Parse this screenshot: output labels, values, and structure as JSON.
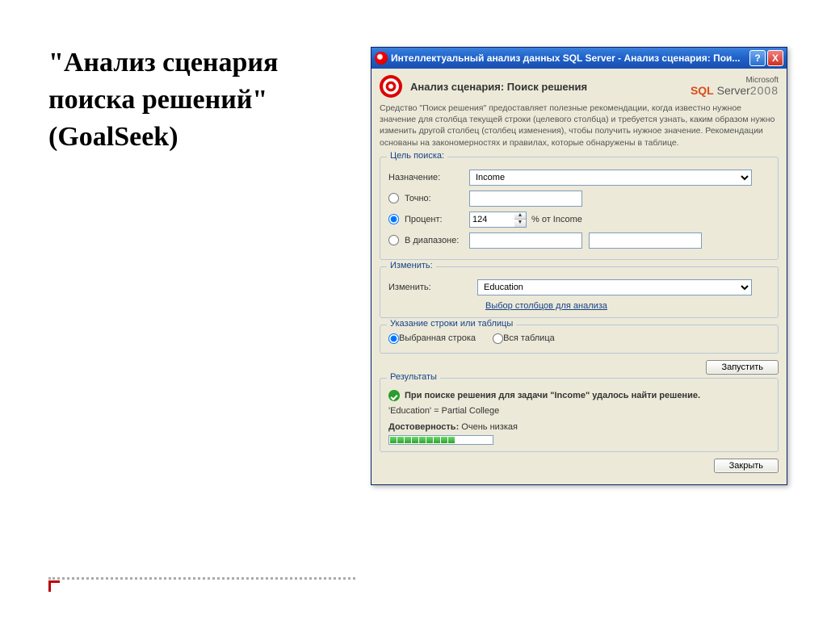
{
  "slide": {
    "title_line1": "\"Анализ сценария",
    "title_line2": "поиска решений\"",
    "title_line3": "(GoalSeek)"
  },
  "window": {
    "title": "Интеллектуальный анализ данных SQL Server  -  Анализ сценария: Пои...",
    "help": "?",
    "close": "X"
  },
  "header": {
    "heading": "Анализ сценария: Поиск решения",
    "logo_top": "Microsoft",
    "logo_sql_prefix": "SQL",
    "logo_sql_rest": " Server",
    "logo_year": "2008"
  },
  "description": "Средство \"Поиск решения\" предоставляет полезные рекомендации, когда известно нужное значение для столбца текущей строки (целевого столбца) и требуется узнать, каким образом нужно изменить другой столбец (столбец изменения), чтобы получить нужное значение. Рекомендации основаны на закономерностях и правилах, которые обнаружены в таблице.",
  "goal": {
    "legend": "Цель поиска:",
    "assign_label": "Назначение:",
    "assign_value": "Income",
    "exact_label": "Точно:",
    "exact_value": "",
    "percent_label": "Процент:",
    "percent_value": "124",
    "percent_suffix": "% от Income",
    "range_label": "В диапазоне:",
    "range_from": "",
    "range_to": ""
  },
  "change": {
    "legend": "Изменить:",
    "label": "Изменить:",
    "value": "Education",
    "link": "Выбор столбцов для анализа"
  },
  "scope": {
    "legend": "Указание строки или таблицы",
    "row_label": "Выбранная строка",
    "table_label": "Вся таблица"
  },
  "run_button": "Запустить",
  "results": {
    "legend": "Результаты",
    "success_msg": "При поиске решения для задачи \"Income\" удалось найти решение.",
    "detail": "'Education' = Partial College",
    "conf_label": "Достоверность:",
    "conf_value": "Очень низкая"
  },
  "close_button": "Закрыть"
}
